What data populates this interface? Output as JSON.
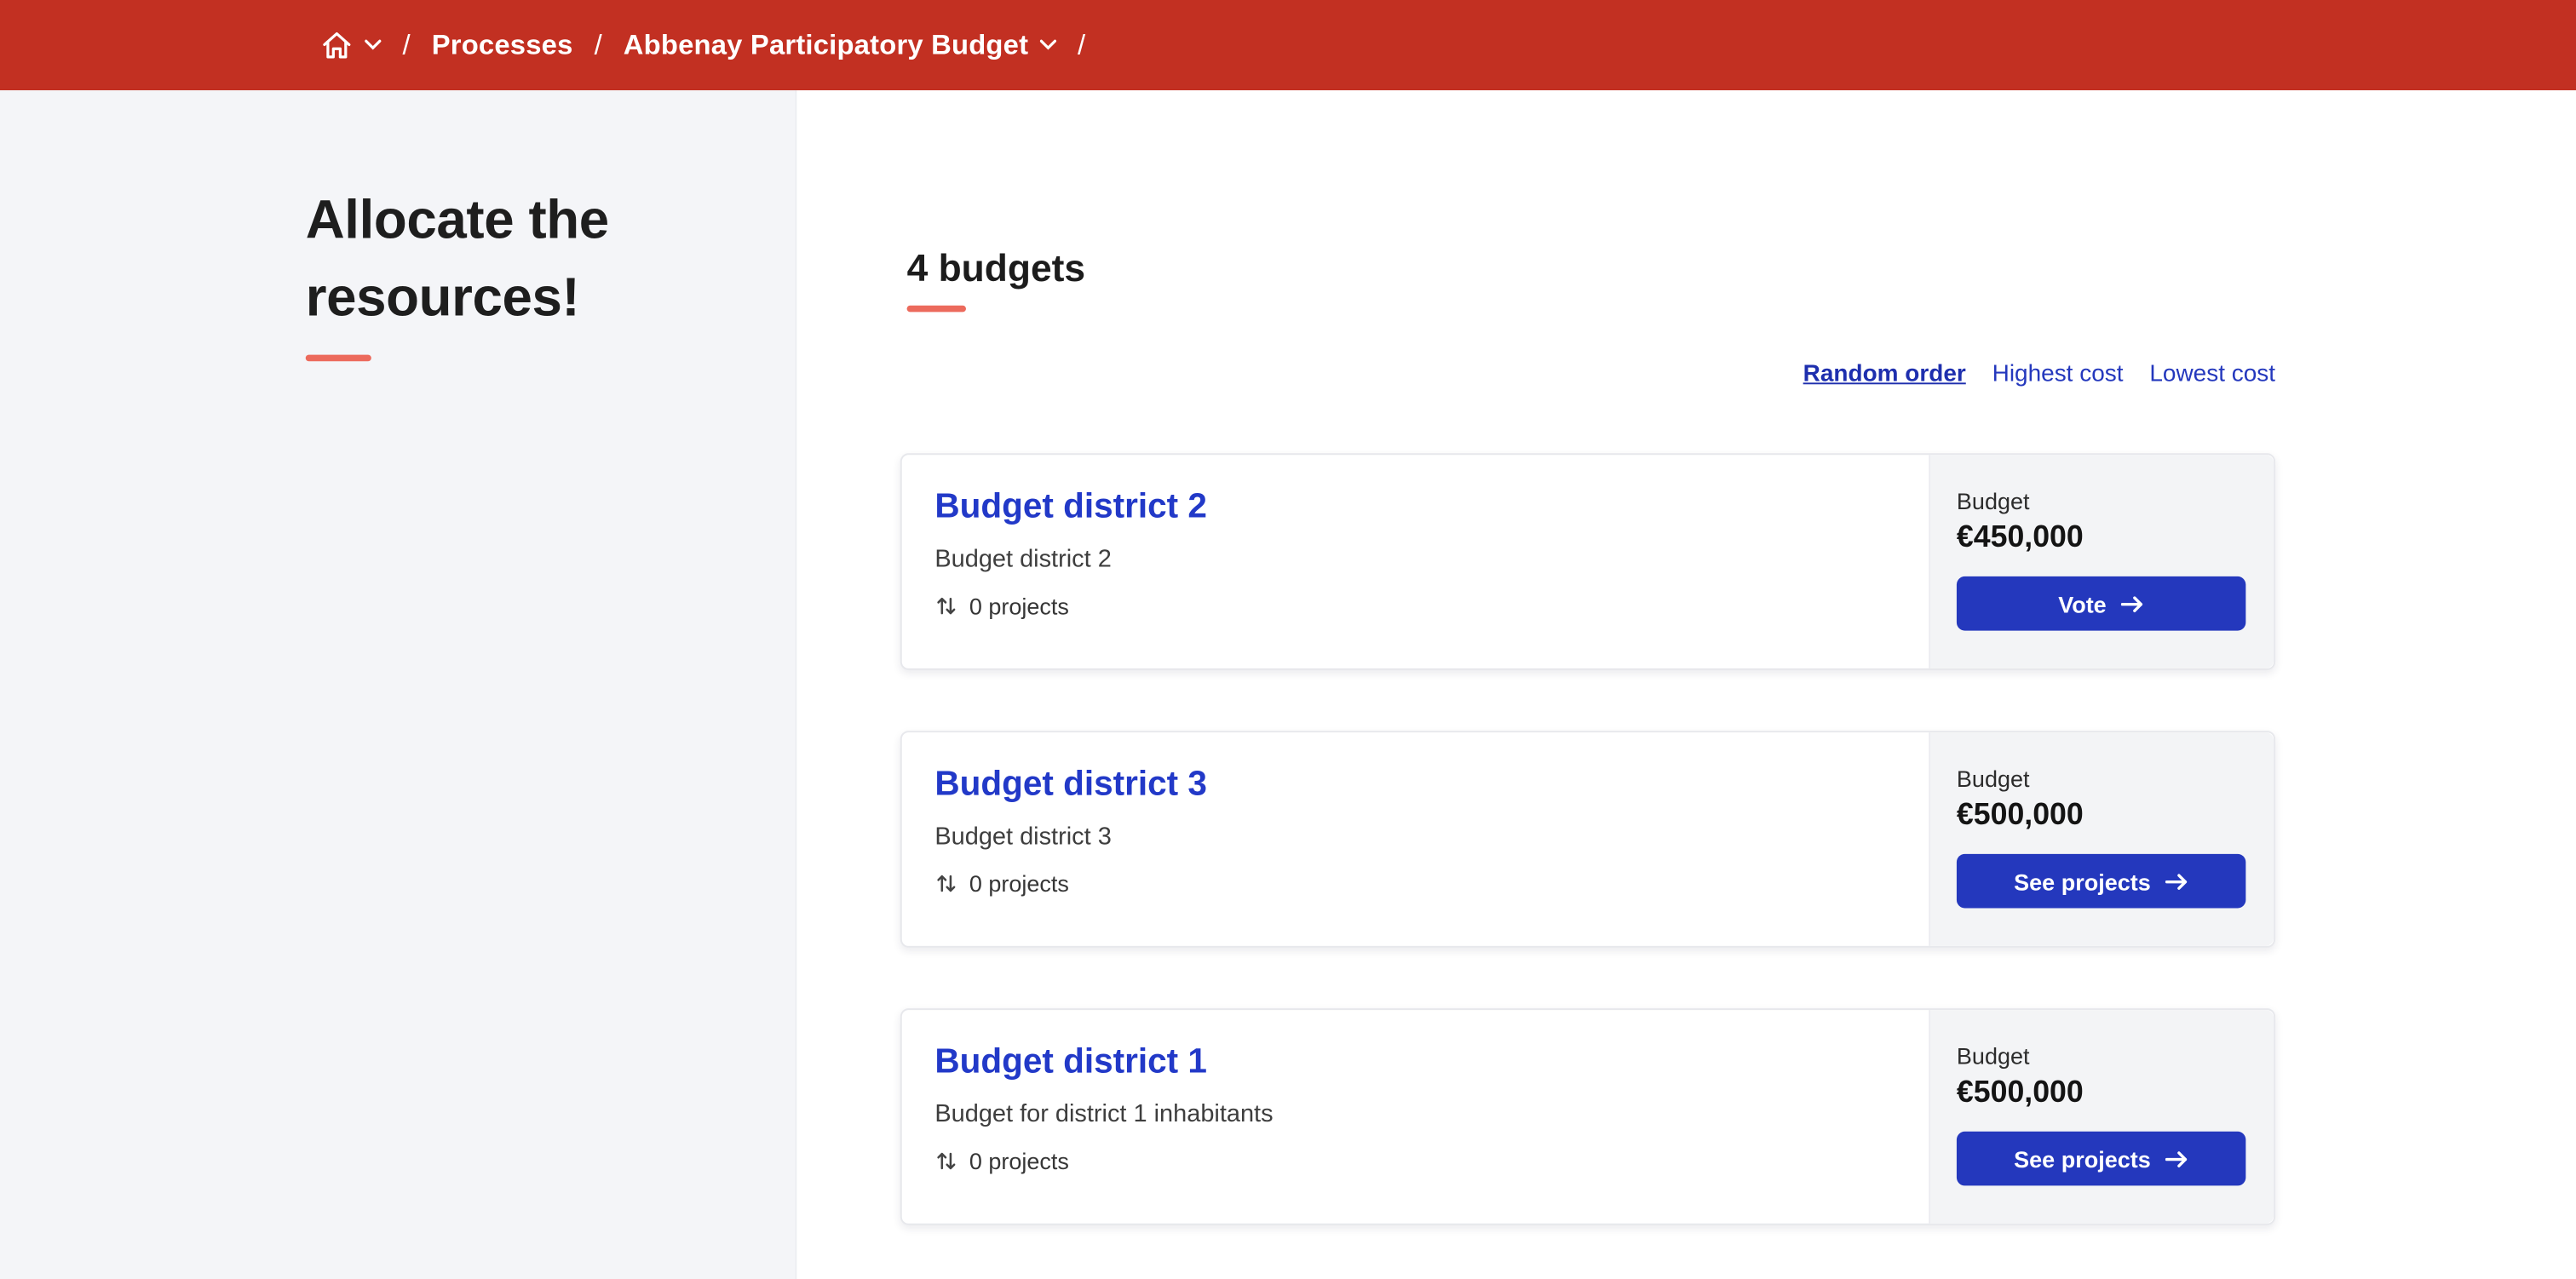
{
  "breadcrumb": {
    "separator": "/",
    "items": [
      {
        "label": "Processes"
      },
      {
        "label": "Abbenay Participatory Budget"
      }
    ]
  },
  "sidebar": {
    "title": "Allocate the resources!"
  },
  "main": {
    "count_heading": "4 budgets",
    "sort_options": [
      {
        "label": "Random order",
        "active": true
      },
      {
        "label": "Highest cost",
        "active": false
      },
      {
        "label": "Lowest cost",
        "active": false
      }
    ],
    "budgets": [
      {
        "title": "Budget district 2",
        "description": "Budget district 2",
        "projects_count": "0 projects",
        "budget_label": "Budget",
        "amount": "€450,000",
        "button_label": "Vote"
      },
      {
        "title": "Budget district 3",
        "description": "Budget district 3",
        "projects_count": "0 projects",
        "budget_label": "Budget",
        "amount": "€500,000",
        "button_label": "See projects"
      },
      {
        "title": "Budget district 1",
        "description": "Budget for district 1 inhabitants",
        "projects_count": "0 projects",
        "budget_label": "Budget",
        "amount": "€500,000",
        "button_label": "See projects"
      }
    ]
  },
  "icons": {
    "home": "home-icon",
    "chevron_down": "chevron-down-icon",
    "projects": "projects-icon",
    "arrow_right": "arrow-right-icon"
  },
  "colors": {
    "topbar_red": "#c23022",
    "accent_salmon": "#ec6a5c",
    "link_blue": "#2438bd",
    "title_blue": "#2239c8",
    "sidebar_bg": "#f4f5f8",
    "card_side_bg": "#f3f4f6"
  }
}
